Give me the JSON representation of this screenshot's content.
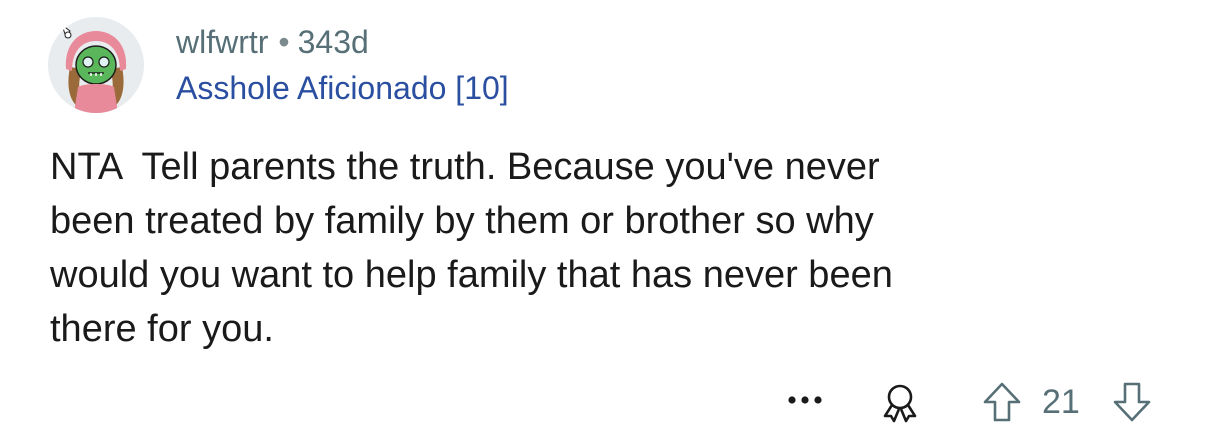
{
  "comment": {
    "author": "wlfwrtr",
    "separator": "•",
    "age": "343d",
    "flair": "Asshole Aficionado [10]",
    "body": "NTA  Tell parents the truth. Because you've never\nbeen treated by family by them or brother so why\nwould you want to help family that has never been\nthere for you.",
    "score": "21"
  },
  "icons": {
    "avatar": "avatar-icon",
    "more": "more-options-icon",
    "award": "award-icon",
    "upvote": "upvote-arrow-icon",
    "downvote": "downvote-arrow-icon"
  },
  "colors": {
    "username": "#576f76",
    "flair": "#2a4fa0",
    "body": "#1a1a1b",
    "icon": "#576f76"
  }
}
